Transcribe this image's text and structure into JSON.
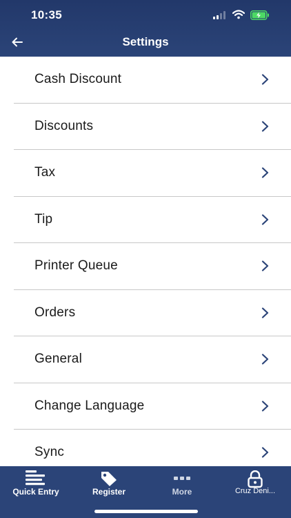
{
  "status_bar": {
    "time": "10:35"
  },
  "header": {
    "title": "Settings"
  },
  "settings": {
    "items": [
      {
        "label": "Cash Discount"
      },
      {
        "label": "Discounts"
      },
      {
        "label": "Tax"
      },
      {
        "label": "Tip"
      },
      {
        "label": "Printer Queue"
      },
      {
        "label": "Orders"
      },
      {
        "label": "General"
      },
      {
        "label": "Change Language"
      },
      {
        "label": "Sync"
      }
    ]
  },
  "tab_bar": {
    "tabs": [
      {
        "label": "Quick Entry",
        "icon": "quick-entry-icon"
      },
      {
        "label": "Register",
        "icon": "tag-icon"
      },
      {
        "label": "More",
        "icon": "more-icon"
      },
      {
        "label": "Cruz Deni...",
        "icon": "lock-icon"
      }
    ]
  },
  "colors": {
    "header_bg": "#22386a",
    "tab_bg": "#2b4478",
    "chevron": "#2b4478",
    "divider": "#c7c7c7",
    "battery": "#4cd964"
  }
}
